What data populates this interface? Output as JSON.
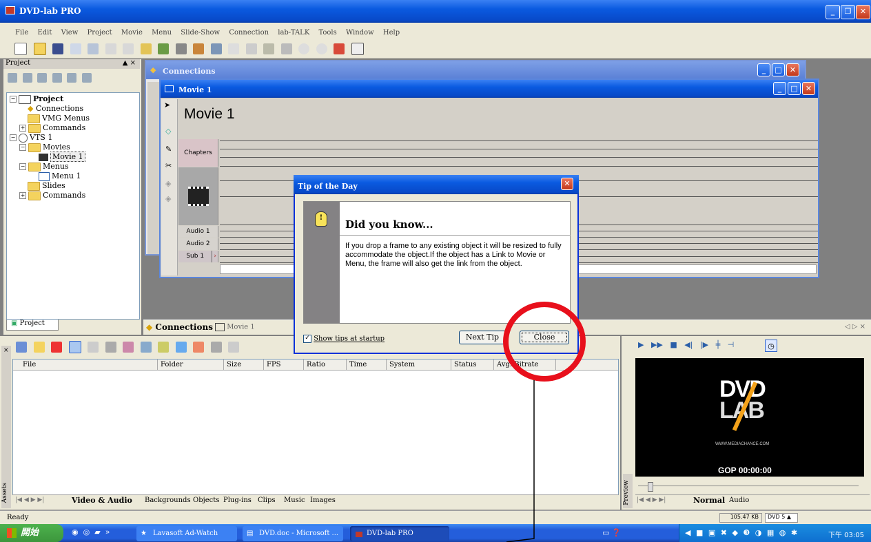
{
  "app": {
    "title": "DVD-lab PRO"
  },
  "menu": [
    "File",
    "Edit",
    "View",
    "Project",
    "Movie",
    "Menu",
    "Slide-Show",
    "Connection",
    "lab-TALK",
    "Tools",
    "Window",
    "Help"
  ],
  "project_panel": {
    "title": "Project",
    "tree": [
      "Project",
      "Connections",
      "VMG Menus",
      "Commands",
      "VTS 1",
      "Movies",
      "Movie 1",
      "Menus",
      "Menu 1",
      "Slides",
      "Commands"
    ],
    "bottom_tab": "Project"
  },
  "connections_window": {
    "title": "Connections"
  },
  "movie_window": {
    "title": "Movie 1",
    "heading": "Movie 1",
    "tracks": {
      "chapters": "Chapters",
      "audio1": "Audio 1",
      "audio2": "Audio 2",
      "sub1": "Sub 1"
    }
  },
  "doc_tabs": {
    "connections": "Connections",
    "movie": "Movie 1"
  },
  "tip_dialog": {
    "title": "Tip of the Day",
    "heading": "Did you know...",
    "text": "If you drop a frame to any existing object it will be resized to fully accommodate the object.If the object has a Link to Movie or Menu, the frame will also get the link from the object.",
    "checkbox_label": "Show tips at startup",
    "checkbox_checked": true,
    "next_button": "Next Tip",
    "close_button": "Close"
  },
  "assets": {
    "side_label": "Assets",
    "columns": [
      "File",
      "Folder",
      "Size",
      "FPS",
      "Ratio",
      "Time",
      "System",
      "Status",
      "Avg. Bitrate"
    ],
    "tabs": [
      "Video & Audio",
      "Backgrounds",
      "Objects",
      "Plug-ins",
      "Clips",
      "Music",
      "Images"
    ]
  },
  "preview": {
    "side_label": "Preview",
    "logo_top": "DVD",
    "logo_bottom": "LAB",
    "url": "WWW.MEDIACHANCE.COM",
    "gop": "GOP 00:00:00",
    "tabs": [
      "Normal",
      "Audio"
    ]
  },
  "status": {
    "text": "Ready",
    "size": "105.47 KB",
    "dvd": "DVD 5"
  },
  "taskbar": {
    "start": "開始",
    "items": [
      "Lavasoft Ad-Watch",
      "DVD.doc - Microsoft ...",
      "DVD-lab PRO"
    ],
    "clock": "下午 03:05"
  },
  "colors": {
    "xp_blue": "#0a5ae0",
    "highlight_red": "#e8101c",
    "face": "#ece9d8"
  }
}
